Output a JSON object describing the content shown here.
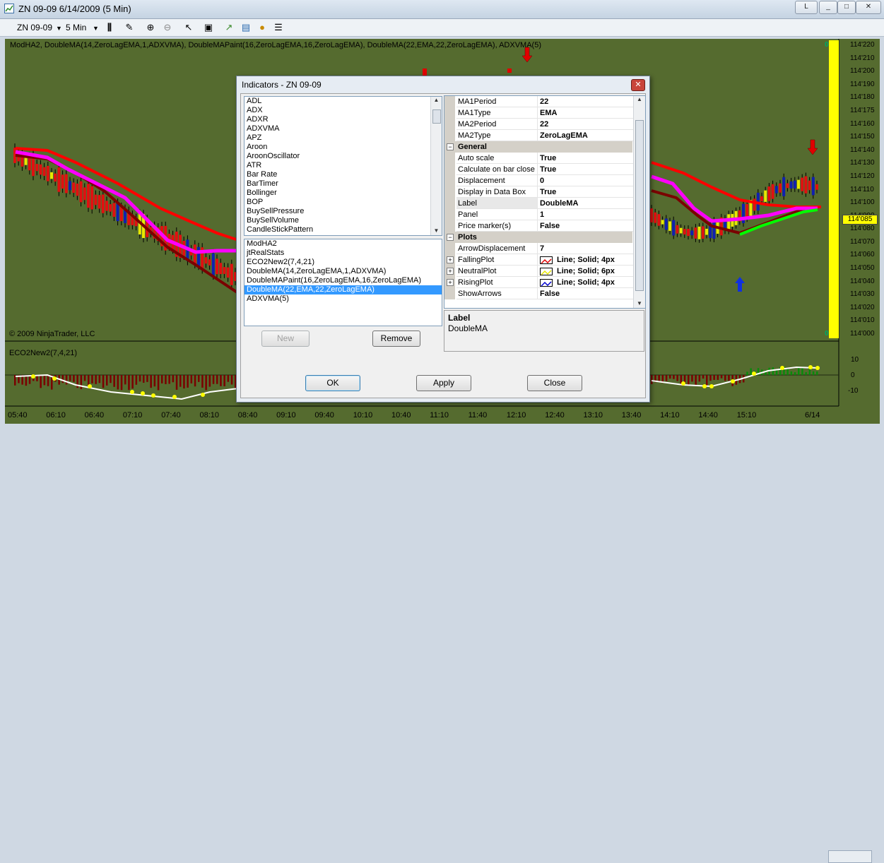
{
  "window": {
    "title": "ZN 09-09  6/14/2009 (5 Min)",
    "buttons": [
      "L",
      "_",
      "□",
      "✕"
    ]
  },
  "toolbar": {
    "instrument": "ZN 09-09",
    "interval": "5 Min"
  },
  "chart": {
    "indicator_caption": "ModHA2, DoubleMA(14,ZeroLagEMA,1,ADXVMA), DoubleMAPaint(16,ZeroLagEMA,16,ZeroLagEMA), DoubleMA(22,EMA,22,ZeroLagEMA), ADXVMA(5)",
    "copyright": "© 2009 NinjaTrader, LLC",
    "price_ticks": [
      "114'220",
      "114'210",
      "114'200",
      "114'190",
      "114'180",
      "114'175",
      "114'160",
      "114'150",
      "114'140",
      "114'130",
      "114'120",
      "114'110",
      "114'100",
      "114'090",
      "114'080",
      "114'070",
      "114'060",
      "114'050",
      "114'040",
      "114'030",
      "114'020",
      "114'010",
      "114'000"
    ],
    "current_price": "114'085",
    "ybar_top": "0",
    "ybar_bottom": "0",
    "lower_panel_title": "ECO2New2(7,4,21)",
    "lower_ticks": [
      "10",
      "0",
      "-10"
    ],
    "time_labels": [
      "05:40",
      "06:10",
      "06:40",
      "07:10",
      "07:40",
      "08:10",
      "08:40",
      "09:10",
      "09:40",
      "10:10",
      "10:40",
      "11:10",
      "11:40",
      "12:10",
      "12:40",
      "13:10",
      "13:40",
      "14:10",
      "14:40",
      "15:10",
      "6/14"
    ]
  },
  "dialog": {
    "title": "Indicators - ZN 09-09",
    "available": [
      "ADL",
      "ADX",
      "ADXR",
      "ADXVMA",
      "APZ",
      "Aroon",
      "AroonOscillator",
      "ATR",
      "Bar Rate",
      "BarTimer",
      "Bollinger",
      "BOP",
      "BuySellPressure",
      "BuySellVolume",
      "CandleStickPattern"
    ],
    "applied": [
      "ModHA2",
      "jtRealStats",
      "ECO2New2(7,4,21)",
      "DoubleMA(14,ZeroLagEMA,1,ADXVMA)",
      "DoubleMAPaint(16,ZeroLagEMA,16,ZeroLagEMA)",
      "DoubleMA(22,EMA,22,ZeroLagEMA)",
      "ADXVMA(5)"
    ],
    "applied_selected_index": 5,
    "buttons": {
      "new": "New",
      "remove": "Remove",
      "ok": "OK",
      "apply": "Apply",
      "close": "Close"
    },
    "properties": [
      {
        "kind": "prop",
        "name": "MA1Period",
        "value": "22"
      },
      {
        "kind": "prop",
        "name": "MA1Type",
        "value": "EMA"
      },
      {
        "kind": "prop",
        "name": "MA2Period",
        "value": "22"
      },
      {
        "kind": "prop",
        "name": "MA2Type",
        "value": "ZeroLagEMA"
      },
      {
        "kind": "cat",
        "name": "General"
      },
      {
        "kind": "prop",
        "name": "Auto scale",
        "value": "True"
      },
      {
        "kind": "prop",
        "name": "Calculate on bar close",
        "value": "True"
      },
      {
        "kind": "prop",
        "name": "Displacement",
        "value": "0"
      },
      {
        "kind": "prop",
        "name": "Display in Data Box",
        "value": "True"
      },
      {
        "kind": "prop",
        "name": "Label",
        "value": "DoubleMA"
      },
      {
        "kind": "prop",
        "name": "Panel",
        "value": "1"
      },
      {
        "kind": "prop",
        "name": "Price marker(s)",
        "value": "False"
      },
      {
        "kind": "cat",
        "name": "Plots"
      },
      {
        "kind": "prop",
        "name": "ArrowDisplacement",
        "value": "7"
      },
      {
        "kind": "plot",
        "name": "FallingPlot",
        "value": "Line; Solid; 4px",
        "color": "#e00000"
      },
      {
        "kind": "plot",
        "name": "NeutralPlot",
        "value": "Line; Solid; 6px",
        "color": "#e6e600"
      },
      {
        "kind": "plot",
        "name": "RisingPlot",
        "value": "Line; Solid; 4px",
        "color": "#0000d0"
      },
      {
        "kind": "prop",
        "name": "ShowArrows",
        "value": "False"
      }
    ],
    "description": {
      "heading": "Label",
      "text": "DoubleMA"
    }
  },
  "colors": {
    "chart_bg": "#556b2f",
    "up_line": "#ff00ff",
    "down_line": "#ff0000",
    "rising": "#00ff00",
    "dark_ma": "#7a0000",
    "marker": "#ffff00"
  }
}
